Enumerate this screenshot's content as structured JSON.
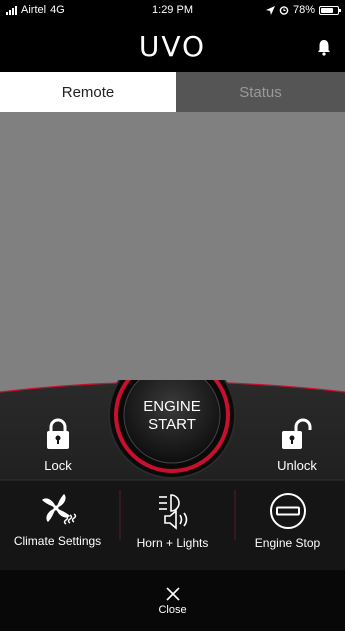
{
  "status_bar": {
    "carrier": "Airtel",
    "network": "4G",
    "time": "1:29 PM",
    "battery": "78%",
    "battery_level": 0.78
  },
  "header": {
    "logo_text": "UVO",
    "bell_icon": "bell-icon"
  },
  "tabs": [
    {
      "label": "Remote",
      "active": true
    },
    {
      "label": "Status",
      "active": false
    }
  ],
  "controls": {
    "engine_start": [
      "ENGINE",
      "START"
    ],
    "lock_label": "Lock",
    "unlock_label": "Unlock"
  },
  "actions": [
    {
      "label": "Climate Settings",
      "icon": "fan-icon"
    },
    {
      "label": "Horn + Lights",
      "icon": "horn-lights-icon"
    },
    {
      "label": "Engine Stop",
      "icon": "engine-stop-icon"
    }
  ],
  "close_label": "Close",
  "colors": {
    "accent_red": "#c8102e",
    "main_gray": "#808080",
    "tab_inactive": "#555555"
  }
}
